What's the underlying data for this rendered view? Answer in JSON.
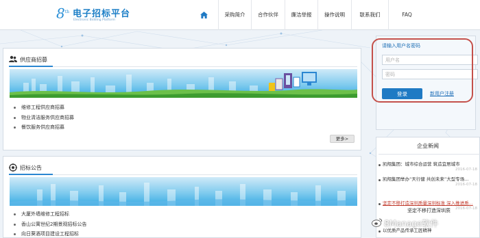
{
  "header": {
    "logo_mark": "8",
    "logo_mark_sup": "th",
    "title": "电子招标平台",
    "subtitle": "Electronic Bidding Platform",
    "home_icon": "home-icon",
    "nav": [
      "采购简介",
      "合作伙伴",
      "廉洁举报",
      "操作说明",
      "联系我们",
      "FAQ"
    ]
  },
  "supplier": {
    "heading": "供应商招募",
    "items": [
      "维修工程供应商招募",
      "物业清洁服务供应商招募",
      "餐饮服务供应商招募"
    ],
    "more": "更多>"
  },
  "tender": {
    "heading": "招标公告",
    "items": [
      "大厦外墙维修工程招标",
      "香山公寓世纪2期景观招标公告",
      "向日葵酒项目建设工程招标"
    ]
  },
  "login": {
    "heading": "请输入用户名密码",
    "username_placeholder": "用户名",
    "password_placeholder": "密码",
    "login_button": "登录",
    "register_link": "新用户注册"
  },
  "news": {
    "heading": "企业新闻",
    "items": [
      {
        "text": "凯翔集团：城市综合运营 筑造宜居城市",
        "date": "2016-07-18"
      },
      {
        "text": "凯翔集团举办“天行健 共创未来”大型专场...",
        "date": "2016-07-18"
      },
      {
        "text": "坚定不移打造深圳质量深圳标准 深入推进质...",
        "date": "2016-07-18"
      },
      {
        "text": "以优质产品传承工匠精神",
        "date": ""
      }
    ],
    "overlay_text": "坚定不移打造深圳质"
  },
  "watermark": {
    "text": "8Manage软件"
  },
  "colors": {
    "accent": "#1f7ac4",
    "highlight_ring": "#c4504a",
    "alert_text": "#c0392b"
  }
}
